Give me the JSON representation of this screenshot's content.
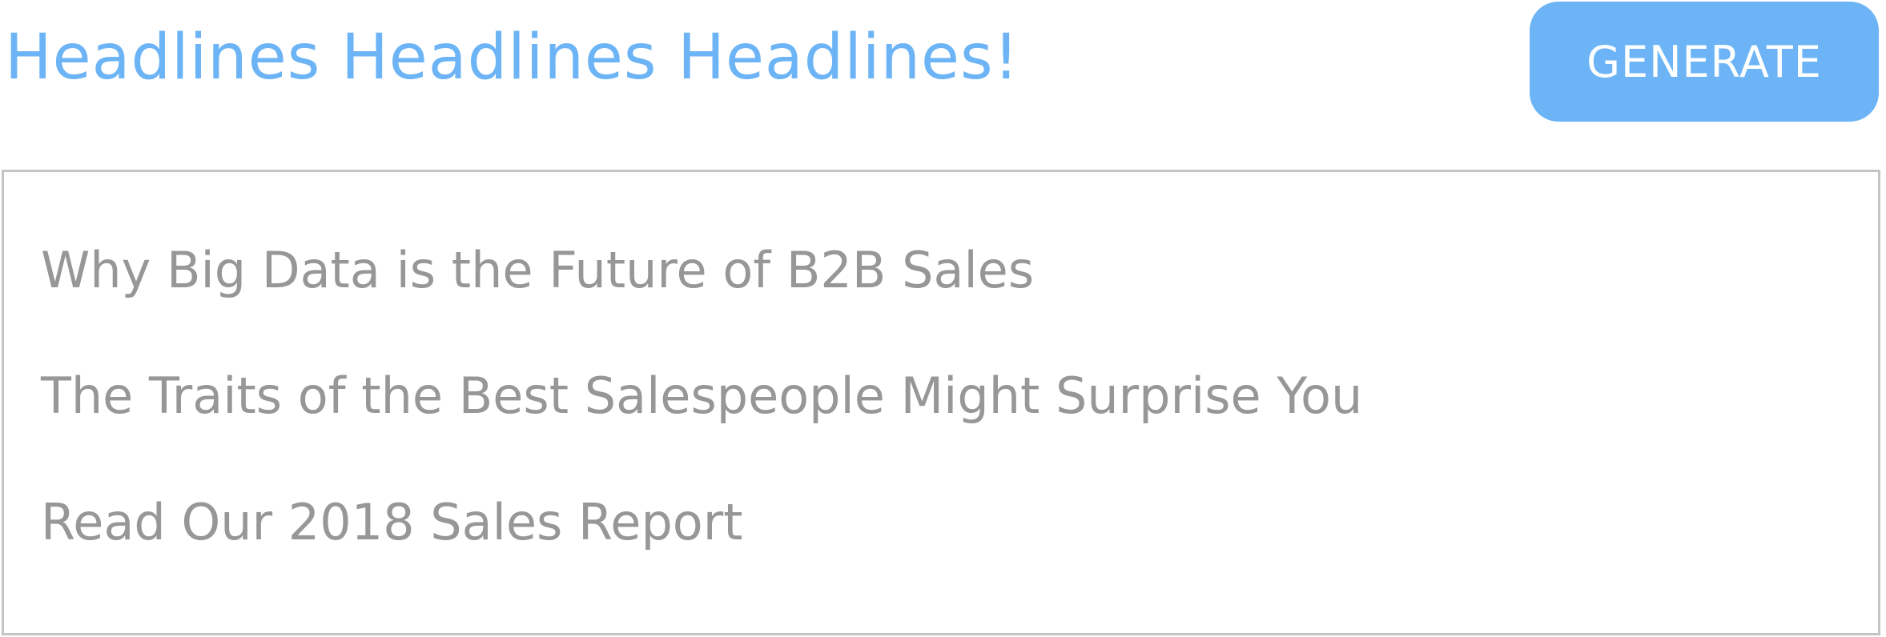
{
  "header": {
    "title": "Headlines Headlines Headlines!",
    "generate_label": "GENERATE"
  },
  "results": {
    "headlines": [
      "Why Big Data is the Future of B2B Sales",
      "The Traits of the Best Salespeople Might Surprise You",
      "Read Our 2018 Sales Report"
    ]
  },
  "colors": {
    "accent": "#6cb4f5",
    "headline_text": "#979797",
    "panel_border": "#c4c4c4",
    "button_text": "#ffffff"
  }
}
